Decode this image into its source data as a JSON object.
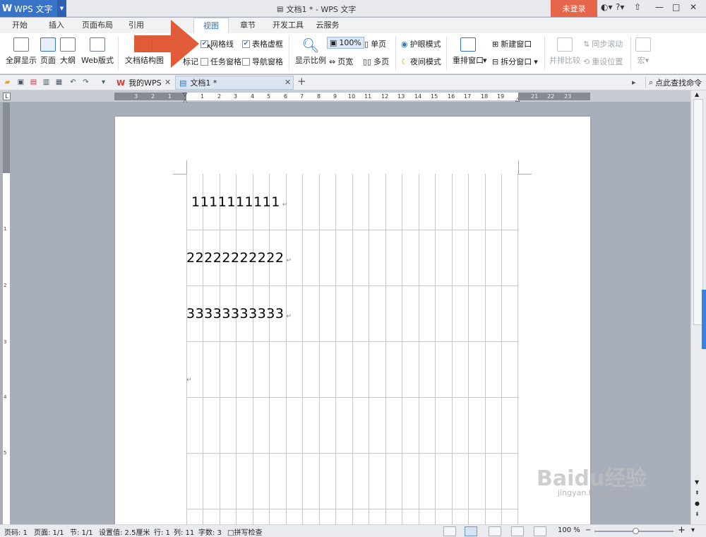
{
  "titlebar": {
    "app_name": "WPS 文字",
    "doc_title": "文档1 * - WPS 文字",
    "login_label": "未登录",
    "help_label": "?"
  },
  "tabs": [
    "开始",
    "插入",
    "页面布局",
    "引用",
    "视图",
    "章节",
    "开发工具",
    "云服务"
  ],
  "active_tab": "视图",
  "ribbon": {
    "fullscreen": "全屏显示",
    "page": "页面",
    "outline": "大纲",
    "web": "Web版式",
    "doc_structure": "文档结构图",
    "gridlines": "网格线",
    "table_dashed": "表格虚框",
    "marks": "标记",
    "task_pane": "任务窗格",
    "nav_pane": "导航窗格",
    "zoom_ratio": "显示比例",
    "zoom_100": "100%",
    "page_width": "页宽",
    "single_page": "单页",
    "multi_page": "多页",
    "eye_mode": "护眼模式",
    "night_mode": "夜间模式",
    "rearrange": "重排窗口",
    "new_window": "新建窗口",
    "split_window": "拆分窗口",
    "side_by_side": "并排比较",
    "sync_scroll": "同步滚动",
    "reset_pos": "重设位置",
    "macro": "宏"
  },
  "checkbox_states": {
    "gridlines": true,
    "table_dashed": true,
    "task_pane": false,
    "nav_pane": false
  },
  "doctabs": {
    "mywps": "我的WPS",
    "doc1": "文档1 *",
    "search": "点此查找命令"
  },
  "ruler_h": [
    "3",
    "2",
    "1",
    "1",
    "2",
    "3",
    "4",
    "5",
    "6",
    "7",
    "8",
    "9",
    "10",
    "11",
    "12",
    "13",
    "14",
    "15",
    "16",
    "17",
    "18",
    "19",
    "21",
    "22",
    "23"
  ],
  "ruler_v": [
    "1",
    "2",
    "3",
    "4",
    "5"
  ],
  "document": {
    "line1": "1111111111",
    "line2": "22222222222",
    "line3": "33333333333",
    "mark": "↵"
  },
  "status": {
    "page_num": "页码: 1",
    "pages": "页面: 1/1",
    "section": "节: 1/1",
    "setting": "设置值: 2.5厘米",
    "row": "行: 1",
    "col": "列: 11",
    "words": "字数: 3",
    "spell": "拼写检查",
    "zoom": "100 %"
  },
  "watermark": {
    "brand": "Baidu经验",
    "url": "jingyan.baidu.com"
  }
}
